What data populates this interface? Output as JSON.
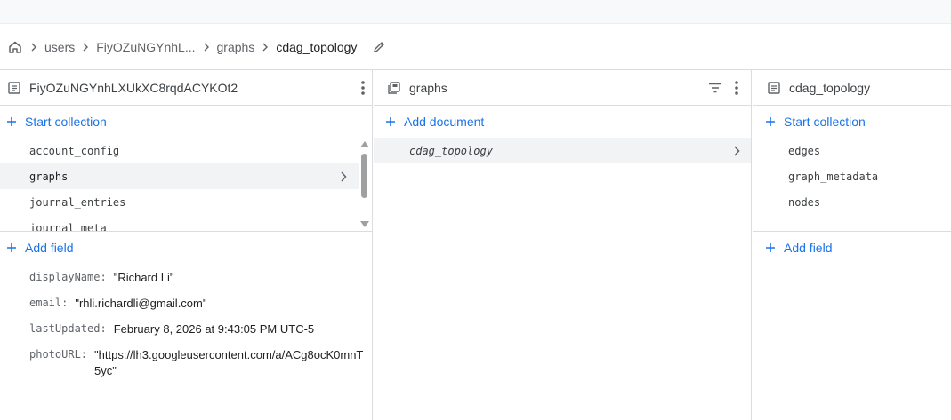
{
  "breadcrumb": {
    "items": [
      "users",
      "FiyOZuNGYnhL...",
      "graphs"
    ],
    "current": "cdag_topology"
  },
  "panel1": {
    "title": "FiyOZuNGYnhLXUkXC8rqdACYKOt2",
    "start_collection": "Start collection",
    "collections": [
      "account_config",
      "graphs",
      "journal_entries",
      "journal_meta"
    ],
    "add_field": "Add field",
    "fields": [
      {
        "key": "displayName:",
        "value": "\"Richard Li\""
      },
      {
        "key": "email:",
        "value": "\"rhli.richardli@gmail.com\""
      },
      {
        "key": "lastUpdated:",
        "value": "February 8, 2026 at 9:43:05 PM UTC-5"
      },
      {
        "key": "photoURL:",
        "value": "\"https://lh3.googleusercontent.com/a/ACg8ocK0mnT5yc\""
      }
    ]
  },
  "panel2": {
    "title": "graphs",
    "add_document": "Add document",
    "documents": [
      "cdag_topology"
    ]
  },
  "panel3": {
    "title": "cdag_topology",
    "start_collection": "Start collection",
    "collections": [
      "edges",
      "graph_metadata",
      "nodes"
    ],
    "add_field": "Add field"
  },
  "colors": {
    "accent": "#1a73e8",
    "selected_bg": "#f1f3f4",
    "border": "#dadce0"
  }
}
